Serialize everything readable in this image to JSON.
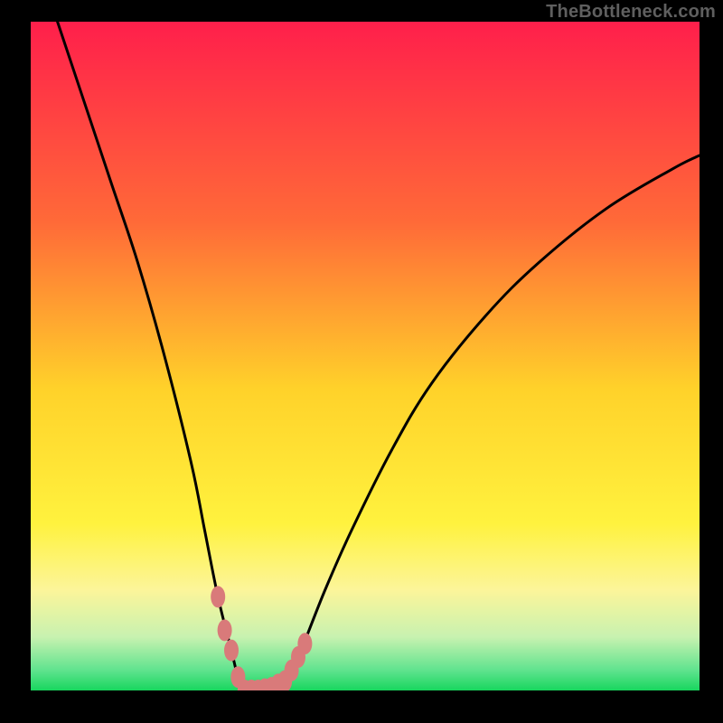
{
  "watermark": "TheBottleneck.com",
  "colors": {
    "red": "#ff1f4b",
    "orange": "#ff8a2a",
    "yellow": "#ffe326",
    "paleyellow": "#fcf59a",
    "lightgreen": "#9cf09c",
    "green": "#18d65e",
    "curve": "#000000",
    "marker": "#d97a7a",
    "frame": "#000000"
  },
  "chart_data": {
    "type": "line",
    "title": "",
    "xlabel": "",
    "ylabel": "",
    "xlim": [
      0,
      100
    ],
    "ylim": [
      0,
      100
    ],
    "series": [
      {
        "name": "bottleneck-curve",
        "x": [
          4,
          8,
          12,
          16,
          20,
          24,
          26,
          28,
          30,
          31,
          32,
          33,
          34,
          36,
          38,
          40,
          44,
          48,
          54,
          60,
          68,
          76,
          86,
          96,
          100
        ],
        "y": [
          100,
          88,
          76,
          64,
          50,
          34,
          24,
          14,
          6,
          2,
          0,
          0,
          0,
          0.4,
          1.4,
          5,
          15,
          24,
          36,
          46,
          56,
          64,
          72,
          78,
          80
        ]
      }
    ],
    "markers": {
      "name": "highlight-segment",
      "points": [
        {
          "x": 28,
          "y": 14
        },
        {
          "x": 29,
          "y": 9
        },
        {
          "x": 30,
          "y": 6
        },
        {
          "x": 31,
          "y": 2
        },
        {
          "x": 32,
          "y": 0
        },
        {
          "x": 33,
          "y": 0
        },
        {
          "x": 34,
          "y": 0
        },
        {
          "x": 35,
          "y": 0.2
        },
        {
          "x": 36,
          "y": 0.4
        },
        {
          "x": 37,
          "y": 0.9
        },
        {
          "x": 38,
          "y": 1.4
        },
        {
          "x": 39,
          "y": 3
        },
        {
          "x": 40,
          "y": 5
        },
        {
          "x": 41,
          "y": 7
        }
      ]
    },
    "gradient_stops": [
      {
        "offset": 0,
        "color": "#ff1f4b"
      },
      {
        "offset": 30,
        "color": "#ff6a38"
      },
      {
        "offset": 55,
        "color": "#ffd22a"
      },
      {
        "offset": 75,
        "color": "#fff23e"
      },
      {
        "offset": 85,
        "color": "#fcf59a"
      },
      {
        "offset": 92,
        "color": "#c8f2b0"
      },
      {
        "offset": 97,
        "color": "#5fe38e"
      },
      {
        "offset": 100,
        "color": "#18d65e"
      }
    ]
  }
}
